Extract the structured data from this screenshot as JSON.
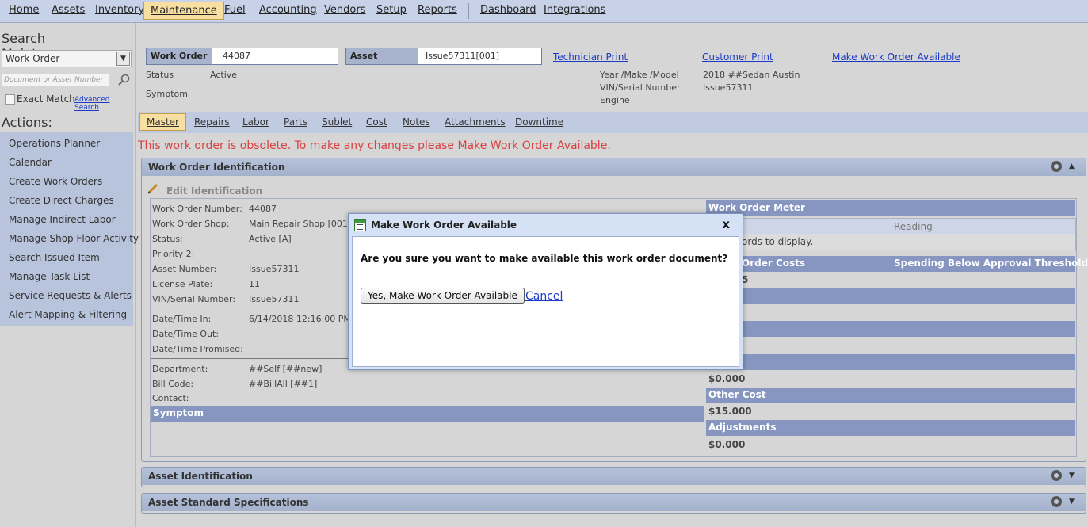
{
  "topnav": {
    "items": [
      "Home",
      "Assets",
      "Inventory",
      "Maintenance",
      "Fuel",
      "Accounting",
      "Vendors",
      "Setup",
      "Reports",
      "Dashboard",
      "Integrations"
    ]
  },
  "sidebar": {
    "search_title": "Search Maintenance:",
    "select_value": "Work Order",
    "search_placeholder": "Document or Asset Number",
    "exact_match": "Exact Match",
    "advanced_search": "Advanced Search",
    "actions_title": "Actions:",
    "actions": [
      "Operations Planner",
      "Calendar",
      "Create Work Orders",
      "Create Direct Charges",
      "Manage Indirect Labor",
      "Manage Shop Floor Activity",
      "Search Issued Item",
      "Manage Task List",
      "Service Requests & Alerts",
      "Alert Mapping & Filtering"
    ]
  },
  "header": {
    "wo_label": "Work Order",
    "wo_value": "44087",
    "asset_label": "Asset",
    "asset_value": "Issue57311[001]",
    "technician_print": "Technician Print",
    "customer_print": "Customer Print",
    "make_available": "Make Work Order Available",
    "status_label": "Status",
    "status_value": "Active",
    "symptom_label": "Symptom",
    "ymm_label": "Year /Make /Model",
    "ymm_value": "2018 ##Sedan Austin",
    "vin_label": "VIN/Serial Number",
    "vin_value": "Issue57311",
    "engine_label": "Engine"
  },
  "tabs": [
    "Master",
    "Repairs",
    "Labor",
    "Parts",
    "Sublet",
    "Cost",
    "Notes",
    "Attachments",
    "Downtime"
  ],
  "warning": "This work order is obsolete. To make any changes please Make Work Order Available.",
  "woid": {
    "title": "Work Order Identification",
    "edit_label": "Edit Identification",
    "rows": [
      {
        "label": "Work Order Number:",
        "value": "44087"
      },
      {
        "label": "Work Order Shop:",
        "value": "Main Repair Shop [001]"
      },
      {
        "label": "Status:",
        "value": "Active [A]"
      },
      {
        "label": "Priority 2:",
        "value": ""
      },
      {
        "label": "Asset Number:",
        "value": "Issue57311"
      },
      {
        "label": "License Plate:",
        "value": "11"
      },
      {
        "label": "VIN/Serial Number:",
        "value": "Issue57311"
      }
    ],
    "dates": [
      {
        "label": "Date/Time In:",
        "value": "6/14/2018 12:16:00 PM"
      },
      {
        "label": "Date/Time Out:",
        "value": ""
      },
      {
        "label": "Date/Time Promised:",
        "value": ""
      }
    ],
    "misc": [
      {
        "label": "Department:",
        "value": "##Self [##new]"
      },
      {
        "label": "Bill Code:",
        "value": "##BillAll [##1]"
      },
      {
        "label": "Contact:",
        "value": ""
      }
    ],
    "symptom_bar": "Symptom",
    "meter_title": "Work Order Meter",
    "reading_header": "Reading",
    "no_records_partial": "ords to display.",
    "costs_title_partial": "Order Costs",
    "spending_text": "Spending Below Approval Threshold",
    "cost_partial": "5",
    "cost_value_1": "$0.000",
    "other_cost_title": "Other Cost",
    "other_cost_value": "$15.000",
    "adjustments_title": "Adjustments",
    "adjustments_value": "$0.000"
  },
  "sections": {
    "asset_identification": "Asset Identification",
    "asset_standard_specs": "Asset Standard Specifications"
  },
  "modal": {
    "title": "Make Work Order Available",
    "close": "x",
    "question": "Are you sure you want to make available this work order document?",
    "yes_button": "Yes, Make Work Order Available",
    "cancel": "Cancel"
  }
}
